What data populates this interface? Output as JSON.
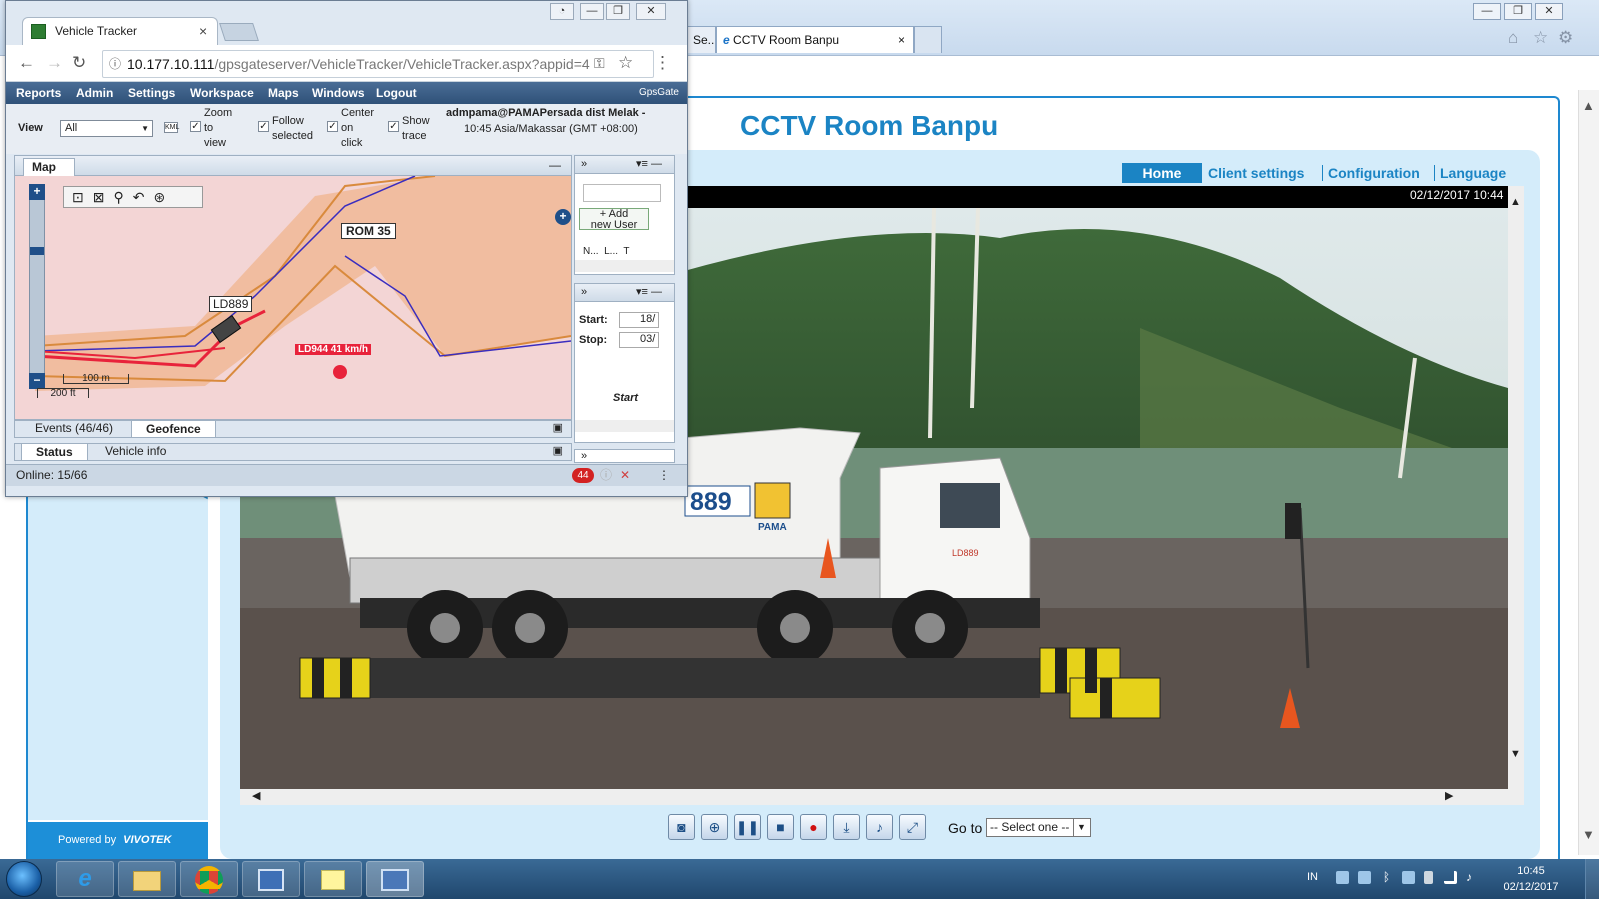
{
  "ie": {
    "tab_prev": "Se...",
    "tab_active": "CCTV Room Banpu",
    "tab_close": "×",
    "window_controls": {
      "minimize": "—",
      "restore": "❐",
      "close": "✕"
    },
    "tools": {
      "home": "⌂",
      "favorites": "☆",
      "settings": "⚙"
    }
  },
  "cctv": {
    "title": "CCTV Room Banpu",
    "nav": {
      "home": "Home",
      "client_settings": "Client settings",
      "configuration": "Configuration",
      "language": "Language"
    },
    "timestamp": "02/12/2017 10:44",
    "powered_by": "Powered by",
    "powered_brand": "VIVOTEK",
    "goto_label": "Go to",
    "goto_selected": "-- Select one --",
    "controls": [
      "snapshot-icon",
      "zoom-icon",
      "pause-icon",
      "stop-icon",
      "record-icon",
      "download-icon",
      "volume-icon",
      "fullscreen-icon"
    ],
    "video_overlay": {
      "truck_number": "889",
      "company": "PAMA",
      "plate": "LD889"
    }
  },
  "vt": {
    "tab_title": "Vehicle Tracker",
    "tab_close": "×",
    "url_host": "10.177.10.111",
    "url_path": "/gpsgateserver/VehicleTracker/VehicleTracker.aspx?appid=4",
    "menu": [
      "Reports",
      "Admin",
      "Settings",
      "Workspace",
      "Maps",
      "Windows",
      "Logout"
    ],
    "brand": "GpsGate",
    "view_label": "View",
    "view_selected": "All",
    "options": {
      "zoom": [
        "Zoom",
        "to",
        "view"
      ],
      "follow": [
        "Follow",
        "selected"
      ],
      "center": [
        "Center",
        "on",
        "click"
      ],
      "show": [
        "Show",
        "trace"
      ]
    },
    "user_line1": "admpama@PAMAPersada dist Melak -",
    "user_line2": "10:45 Asia/Makassar (GMT +08:00)",
    "map_tab": "Map",
    "map_labels": {
      "rom": "ROM 35",
      "vehicle1": "LD889",
      "vehicle2": "LD944 41 km/h",
      "scale_m": "100 m",
      "scale_ft": "200 ft"
    },
    "bottom_tabs": {
      "events": "Events (46/46)",
      "geofence": "Geofence",
      "status": "Status",
      "vehicle_info": "Vehicle info"
    },
    "right_panel": {
      "add_user_line1": "Add",
      "add_user_line2": "new User",
      "col_n": "N...",
      "col_l": "L...",
      "col_t": "T",
      "start_label": "Start:",
      "stop_label": "Stop:",
      "start_value": "18/",
      "stop_value": "03/",
      "start_button": "Start",
      "collapse": "»"
    },
    "online": "Online: 15/66",
    "alarm_count": "44"
  },
  "taskbar": {
    "lang": "IN",
    "time": "10:45",
    "date": "02/12/2017",
    "apps": [
      "internet-explorer",
      "file-explorer",
      "chrome",
      "network-app",
      "sticky-notes",
      "remote-desktop"
    ]
  }
}
